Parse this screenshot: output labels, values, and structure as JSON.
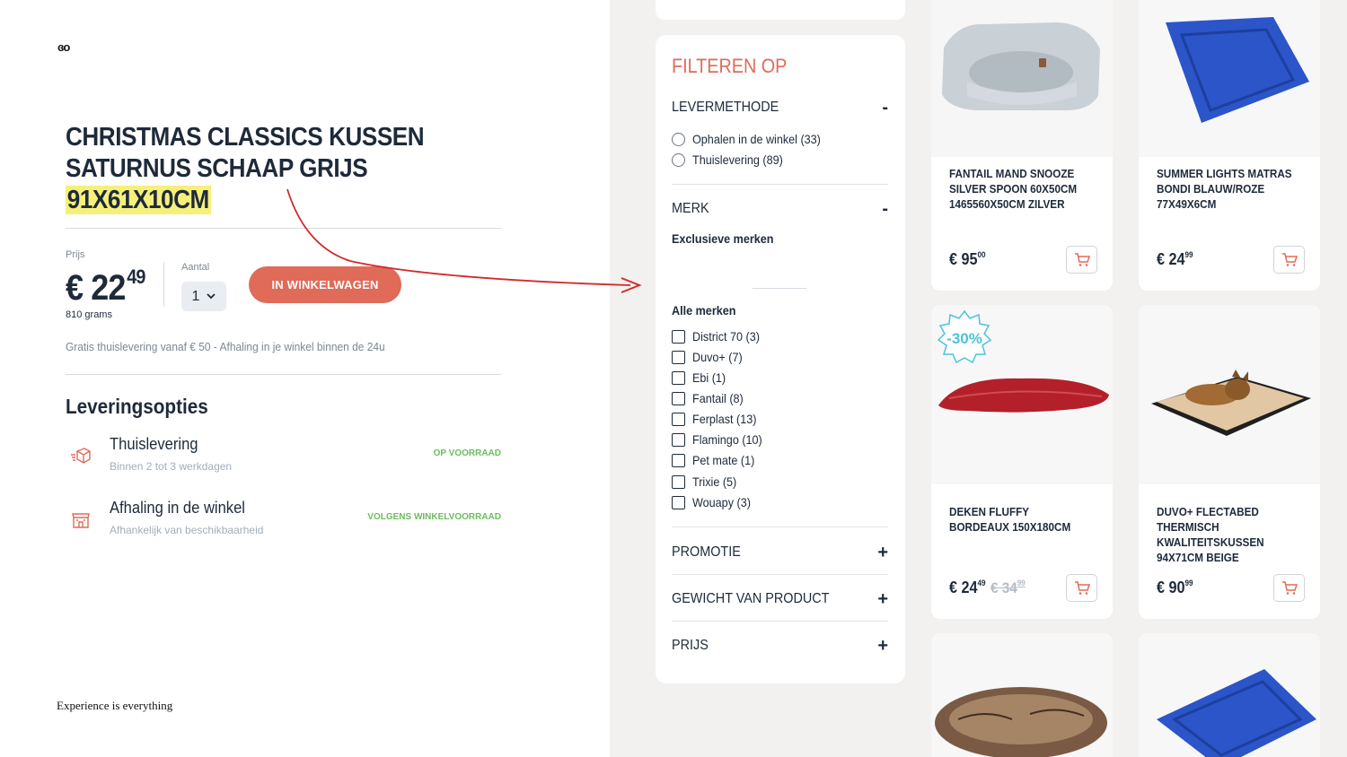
{
  "left": {
    "logo": "ɞo",
    "product_title_main": "CHRISTMAS CLASSICS KUSSEN SATURNUS SCHAAP GRIJS ",
    "product_title_highlight": "91X61X10CM",
    "price_label": "Prijs",
    "price_main": "€ 22",
    "price_cents": "49",
    "weight": "810 grams",
    "quantity_label": "Aantal",
    "quantity_value": "1",
    "add_to_cart": "IN WINKELWAGEN",
    "shipping_note": "Gratis thuislevering vanaf € 50 - Afhaling in je winkel binnen de 24u",
    "delivery_title": "Leveringsopties",
    "delivery_options": [
      {
        "name": "Thuislevering",
        "sub": "Binnen 2 tot 3 werkdagen",
        "status": "OP VOORRAAD",
        "icon": "box-delivery-icon"
      },
      {
        "name": "Afhaling in de winkel",
        "sub": "Afhankelijk van beschikbaarheid",
        "status": "VOLGENS WINKELVOORRAAD",
        "icon": "store-icon"
      }
    ],
    "tagline": "Experience is everything"
  },
  "filter": {
    "title": "FILTEREN OP",
    "sections": {
      "levermethode": {
        "label": "LEVERMETHODE",
        "toggle": "-"
      },
      "merk": {
        "label": "MERK",
        "toggle": "-"
      },
      "promotie": {
        "label": "PROMOTIE",
        "toggle": "+"
      },
      "gewicht": {
        "label": "GEWICHT VAN PRODUCT",
        "toggle": "+"
      },
      "prijs": {
        "label": "PRIJS",
        "toggle": "+"
      }
    },
    "delivery_methods": [
      "Ophalen in de winkel (33)",
      "Thuislevering (89)"
    ],
    "exclusive_brands_label": "Exclusieve merken",
    "all_brands_label": "Alle merken",
    "brands": [
      "District 70 (3)",
      "Duvo+ (7)",
      "Ebi (1)",
      "Fantail (8)",
      "Ferplast (13)",
      "Flamingo (10)",
      "Pet mate (1)",
      "Trixie (5)",
      "Wouapy (3)"
    ]
  },
  "products": [
    {
      "name": "FANTAIL MAND SNOOZE SILVER SPOON 60X50CM 1465560X50CM ZILVER",
      "price_main": "€ 95",
      "price_cents": "00",
      "old_price": ""
    },
    {
      "name": "SUMMER LIGHTS MATRAS BONDI BLAUW/ROZE 77X49X6CM",
      "price_main": "€ 24",
      "price_cents": "99",
      "old_price": ""
    },
    {
      "name": "DEKEN FLUFFY BORDEAUX 150X180CM",
      "price_main": "€ 24",
      "price_cents": "49",
      "old_price": "€ 34",
      "old_cents": "99",
      "badge": "-30%"
    },
    {
      "name": "DUVO+ FLECTABED THERMISCH KWALITEITSKUSSEN 94X71CM BEIGE",
      "price_main": "€ 90",
      "price_cents": "99",
      "old_price": ""
    }
  ],
  "colors": {
    "accent": "#df6b58",
    "stock_green": "#6cbd5e",
    "highlight": "#f6f07a",
    "panel_bg": "#f2f1ef"
  }
}
